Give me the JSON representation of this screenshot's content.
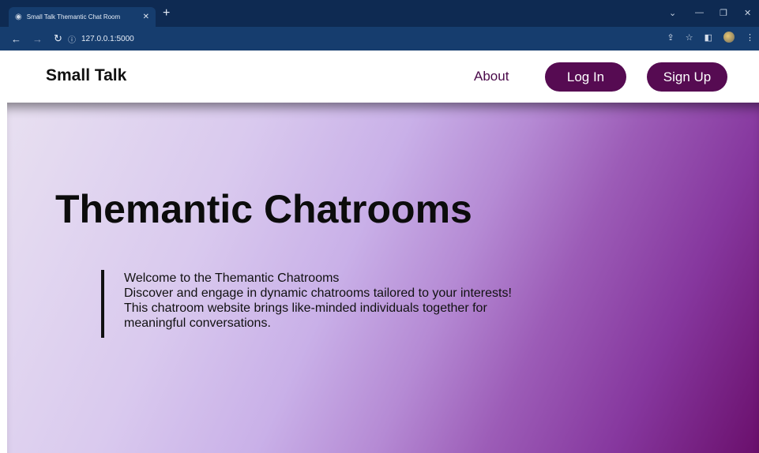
{
  "browser": {
    "tab_title": "Small Talk Themantic Chat Room",
    "url": "127.0.0.1:5000",
    "new_tab": "+",
    "tab_close": "✕"
  },
  "site": {
    "brand": "Small Talk",
    "nav": {
      "about": "About",
      "login": "Log In",
      "signup": "Sign Up"
    }
  },
  "hero": {
    "title": "Themantic Chatrooms",
    "lines": [
      "Welcome to the Themantic Chatrooms",
      "Discover and engage in dynamic chatrooms tailored to your interests!",
      "This chatroom website brings like-minded individuals together for",
      "meaningful conversations."
    ]
  },
  "colors": {
    "accent": "#560b52",
    "chrome_dark": "#0e2a52",
    "chrome_bar": "#163d6e"
  }
}
